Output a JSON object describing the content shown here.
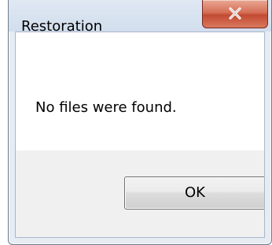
{
  "window": {
    "title": "Restoration"
  },
  "dialog": {
    "message": "No files were found.",
    "ok_label": "OK"
  },
  "icons": {
    "close": "close-icon"
  },
  "colors": {
    "close_button": "#c24a33",
    "content_background": "#ffffff",
    "button_area_background": "#f0f0f0"
  }
}
